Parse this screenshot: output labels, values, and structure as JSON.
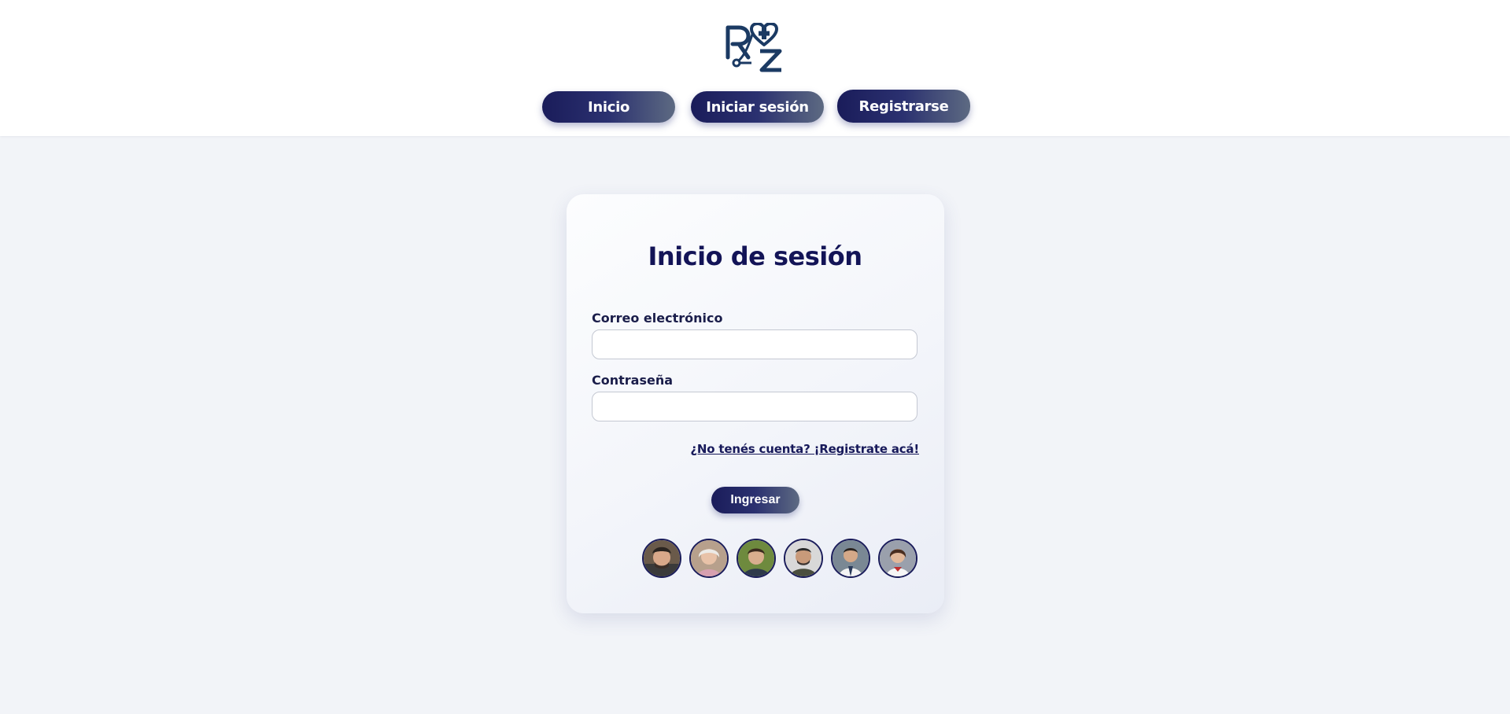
{
  "header": {
    "logo_icon": "rz-stethoscope-heart-logo",
    "nav": {
      "inicio_label": "Inicio",
      "login_label": "Iniciar sesión",
      "register_label": "Registrarse"
    }
  },
  "login": {
    "title": "Inicio de sesión",
    "email_label": "Correo electrónico",
    "email_value": "",
    "password_label": "Contraseña",
    "password_value": "",
    "register_link": "¿No tenés cuenta? ¡Registrate acá!",
    "submit_label": "Ingresar"
  },
  "avatars": [
    {
      "icon": "user-avatar-1"
    },
    {
      "icon": "user-avatar-2"
    },
    {
      "icon": "user-avatar-3"
    },
    {
      "icon": "user-avatar-4"
    },
    {
      "icon": "user-avatar-5"
    },
    {
      "icon": "user-avatar-6"
    }
  ],
  "colors": {
    "brand_navy": "#131457",
    "button_gradient_start": "#1a1c5a",
    "button_gradient_end": "#5d6a82",
    "page_background": "#f2f4f8",
    "logo_color": "#1b3a63"
  }
}
